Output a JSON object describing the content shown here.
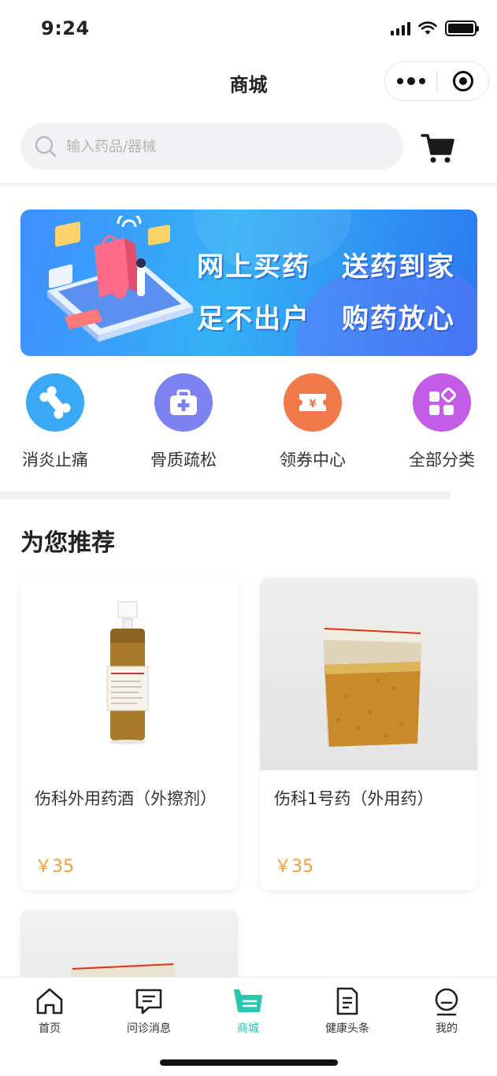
{
  "status_bar": {
    "time": "9:24"
  },
  "nav": {
    "title": "商城"
  },
  "search": {
    "placeholder": "输入药品/器械"
  },
  "banner": {
    "line1_left": "网上买药",
    "line1_right": "送药到家",
    "line2_left": "足不出户",
    "line2_right": "购药放心"
  },
  "categories": [
    {
      "label": "消炎止痛",
      "icon": "bone-joint-icon",
      "color": "#3aa8f5"
    },
    {
      "label": "骨质疏松",
      "icon": "medical-kit-icon",
      "color": "#7c83f0"
    },
    {
      "label": "领券中心",
      "icon": "coupon-icon",
      "color": "#f27a4a"
    },
    {
      "label": "全部分类",
      "icon": "grid-icon",
      "color": "#c35ce6"
    }
  ],
  "section": {
    "title": "为您推荐"
  },
  "products": [
    {
      "name": "伤科外用药酒（外擦剂）",
      "price": "￥35"
    },
    {
      "name": "伤科1号药（外用药）",
      "price": "￥35"
    }
  ],
  "tabs": [
    {
      "label": "首页",
      "icon": "home-icon"
    },
    {
      "label": "问诊消息",
      "icon": "chat-icon"
    },
    {
      "label": "商城",
      "icon": "mall-icon",
      "active": true
    },
    {
      "label": "健康头条",
      "icon": "news-icon"
    },
    {
      "label": "我的",
      "icon": "profile-icon"
    }
  ],
  "colors": {
    "accent": "#2cc5b2",
    "price": "#f0a13a",
    "banner_blue": "#3f8fff"
  }
}
